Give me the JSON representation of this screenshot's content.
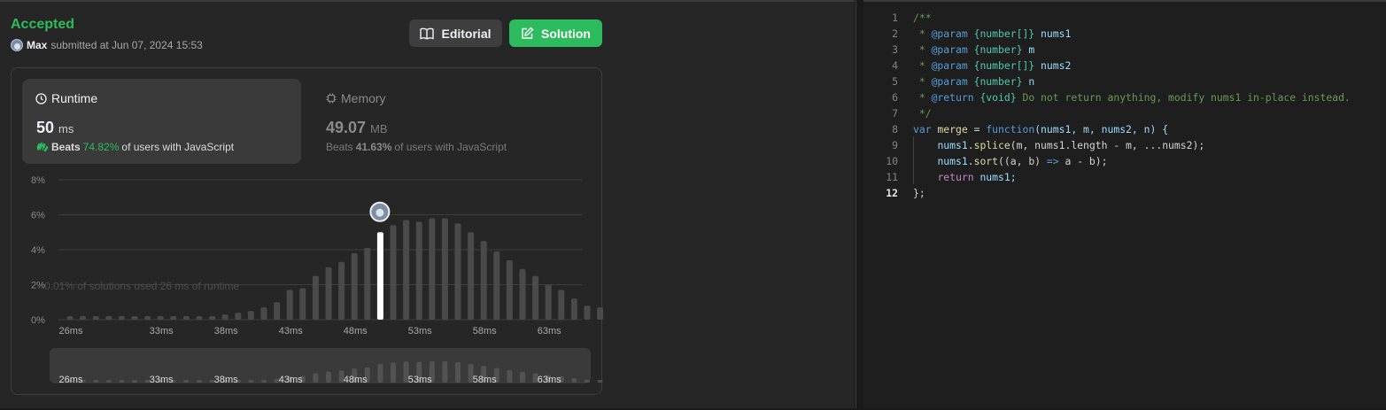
{
  "submission": {
    "status": "Accepted",
    "username": "Max",
    "submitted_text": "submitted at Jun 07, 2024 15:53"
  },
  "buttons": {
    "editorial": "Editorial",
    "solution": "Solution"
  },
  "runtime": {
    "title": "Runtime",
    "value": "50",
    "unit": "ms",
    "beats_label": "Beats",
    "beats_pct": "74.82%",
    "beats_suffix": "of users with JavaScript"
  },
  "memory": {
    "title": "Memory",
    "value": "49.07",
    "unit": "MB",
    "beats_label": "Beats",
    "beats_pct": "41.63%",
    "beats_suffix": "of users with JavaScript"
  },
  "chart_data": {
    "type": "bar",
    "tooltip_text": "0.01% of solutions used 26 ms of runtime",
    "y_ticks": [
      "8%",
      "6%",
      "4%",
      "2%",
      "0%"
    ],
    "ylim": [
      0,
      8
    ],
    "x_tick_labels": [
      "26ms",
      "33ms",
      "38ms",
      "43ms",
      "48ms",
      "53ms",
      "58ms",
      "63ms"
    ],
    "x_tick_values": [
      26,
      33,
      38,
      43,
      48,
      53,
      58,
      63
    ],
    "x": [
      26,
      27,
      28,
      29,
      30,
      31,
      32,
      33,
      34,
      35,
      36,
      37,
      38,
      39,
      40,
      41,
      42,
      43,
      44,
      45,
      46,
      47,
      48,
      49,
      50,
      51,
      52,
      53,
      54,
      55,
      56,
      57,
      58,
      59,
      60,
      61,
      62,
      63,
      64,
      65,
      66,
      67
    ],
    "values": [
      0.2,
      0.2,
      0.2,
      0.2,
      0.2,
      0.2,
      0.2,
      0.2,
      0.2,
      0.2,
      0.2,
      0.2,
      0.3,
      0.4,
      0.5,
      0.7,
      1.0,
      1.7,
      1.8,
      2.5,
      3.0,
      3.3,
      3.8,
      4.1,
      5.0,
      5.4,
      5.7,
      5.6,
      5.8,
      5.8,
      5.5,
      5.0,
      4.5,
      3.9,
      3.4,
      2.9,
      2.5,
      2.0,
      1.7,
      1.2,
      0.8,
      0.7
    ],
    "highlight_x": 50,
    "colors": {
      "bar": "#4a4a4a",
      "highlight": "#ffffff",
      "grid": "#3e3e3e"
    }
  },
  "editor": {
    "lines": [
      {
        "n": "1"
      },
      {
        "n": "2"
      },
      {
        "n": "3"
      },
      {
        "n": "4"
      },
      {
        "n": "5"
      },
      {
        "n": "6"
      },
      {
        "n": "7"
      },
      {
        "n": "8"
      },
      {
        "n": "9"
      },
      {
        "n": "10"
      },
      {
        "n": "11"
      },
      {
        "n": "12"
      }
    ],
    "code": {
      "l1": "/**",
      "l2_a": " * ",
      "l2_tag": "@param",
      "l2_type": " {number[]}",
      "l2_name": " nums1",
      "l3_a": " * ",
      "l3_tag": "@param",
      "l3_type": " {number}",
      "l3_name": " m",
      "l4_a": " * ",
      "l4_tag": "@param",
      "l4_type": " {number[]}",
      "l4_name": " nums2",
      "l5_a": " * ",
      "l5_tag": "@param",
      "l5_type": " {number}",
      "l5_name": " n",
      "l6_a": " * ",
      "l6_tag": "@return",
      "l6_type": " {void}",
      "l6_rest": " Do not return anything, modify nums1 in-place instead.",
      "l7": " */",
      "l8_var": "var",
      "l8_name": " merge",
      "l8_eq": " = ",
      "l8_fn": "function",
      "l8_args": "(nums1, m, nums2, n) {",
      "l9_indent": "    ",
      "l9_obj": "nums1",
      "l9_dot": ".",
      "l9_m": "splice",
      "l9_args": "(m, nums1.length - m, ...nums2);",
      "l10_indent": "    ",
      "l10_obj": "nums1",
      "l10_dot": ".",
      "l10_m": "sort",
      "l10_a": "((a, b) ",
      "l10_arrow": "=>",
      "l10_b": " a - b);",
      "l11_indent": "    ",
      "l11_ret": "return",
      "l11_rest": " nums1;",
      "l12": "};"
    }
  }
}
